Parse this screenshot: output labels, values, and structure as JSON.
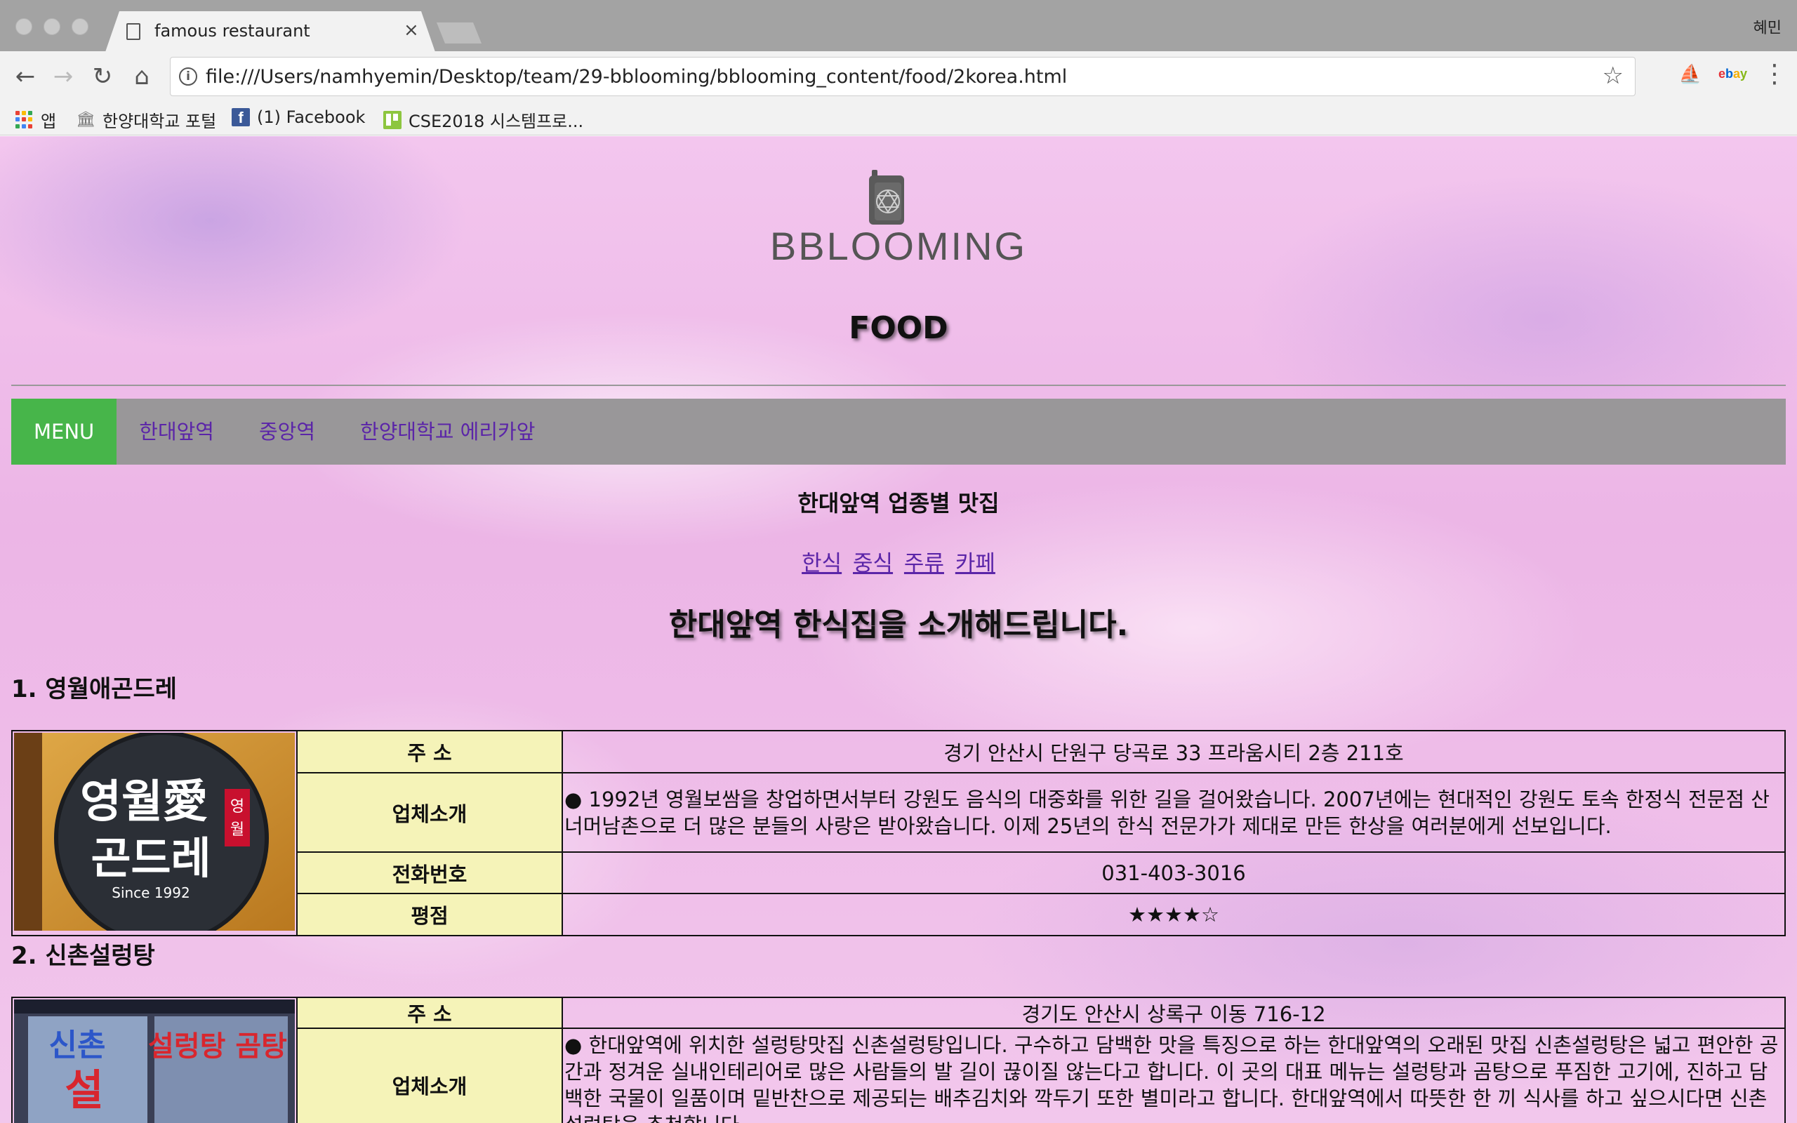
{
  "browser": {
    "tab_title": "famous restaurant",
    "tab_close": "×",
    "profile": "혜민",
    "url": "file:///Users/namhyemin/Desktop/team/29-bblooming/bblooming_content/food/2korea.html",
    "bookmarks": [
      "앱",
      "한양대학교 포털",
      "(1) Facebook",
      "CSE2018 시스템프로..."
    ]
  },
  "site": {
    "logo_text": "BBLOOMING",
    "page_title": "FOOD",
    "nav": {
      "menu_label": "MENU",
      "links": [
        "한대앞역",
        "중앙역",
        "한양대학교 에리카앞"
      ]
    },
    "section_heading": "한대앞역 업종별 맛집",
    "categories": [
      "한식",
      "중식",
      "주류",
      "카페"
    ],
    "intro": "한대앞역 한식집을 소개해드립니다."
  },
  "labels": {
    "address": "주 소",
    "description": "업체소개",
    "phone": "전화번호",
    "rating": "평점"
  },
  "restaurants": [
    {
      "title": "1. 영월애곤드레",
      "sign": {
        "line1": "영월愛",
        "line2": "곤드레",
        "since": "Since 1992",
        "badge": "영월"
      },
      "address": "경기 안산시 단원구 당곡로 33 프라움시티 2층 211호",
      "description": "● 1992년 영월보쌈을 창업하면서부터 강원도 음식의 대중화를 위한 길을 걸어왔습니다. 2007년에는 현대적인 강원도 토속 한정식 전문점 산너머남촌으로 더 많은 분들의 사랑은 받아왔습니다. 이제 25년의 한식 전문가가 제대로 만든 한상을 여러분에게 선보입니다.",
      "phone": "031-403-3016",
      "rating": "★★★★☆"
    },
    {
      "title": "2. 신촌설렁탕",
      "sign": {
        "line1": "신촌",
        "line2": "설렁탕 곰탕"
      },
      "address": "경기도 안산시 상록구 이동 716-12",
      "description": "● 한대앞역에 위치한 설렁탕맛집 신촌설렁탕입니다. 구수하고 담백한 맛을 특징으로 하는 한대앞역의 오래된 맛집 신촌설렁탕은 넓고 편안한 공간과 정겨운 실내인테리어로 많은 사람들의 발 길이 끊이질 않는다고 합니다. 이 곳의 대표 메뉴는 설렁탕과 곰탕으로 푸짐한 고기에, 진하고 담백한 국물이 일품이며 밑반찬으로 제공되는 배추김치와 깍두기 또한 별미라고 합니다. 한대앞역에서 따뜻한 한 끼 식사를 하고 싶으시다면 신촌설렁탕을 추천합니다."
    }
  ],
  "colors": {
    "nav_bg": "#999799",
    "menu_bg": "#47b54a",
    "link": "#5b25a8",
    "label_bg": "#f5f3b8"
  }
}
